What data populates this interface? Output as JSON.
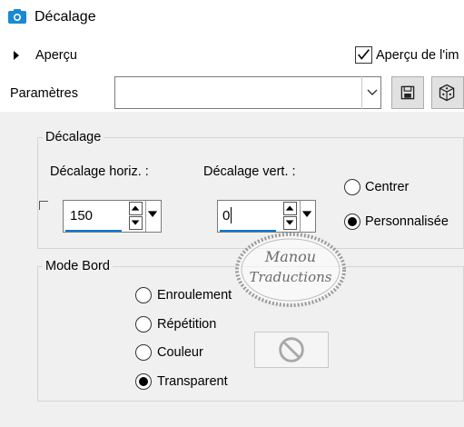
{
  "header": {
    "title": "Décalage",
    "preview_label": "Aperçu",
    "preview_image_label": "Aperçu de l'im",
    "params_label": "Paramètres",
    "params_value": ""
  },
  "offset_group": {
    "legend": "Décalage",
    "horiz_label": "Décalage horiz. :",
    "horiz_value": "150",
    "vert_label": "Décalage vert. :",
    "vert_value": "0",
    "options": [
      "Centrer",
      "Personnalisée"
    ],
    "selected": "Personnalisée"
  },
  "edge_group": {
    "legend": "Mode Bord",
    "options": [
      "Enroulement",
      "Répétition",
      "Couleur",
      "Transparent"
    ],
    "selected": "Transparent"
  },
  "watermark": {
    "line1": "Manou",
    "line2": "Traductions"
  }
}
